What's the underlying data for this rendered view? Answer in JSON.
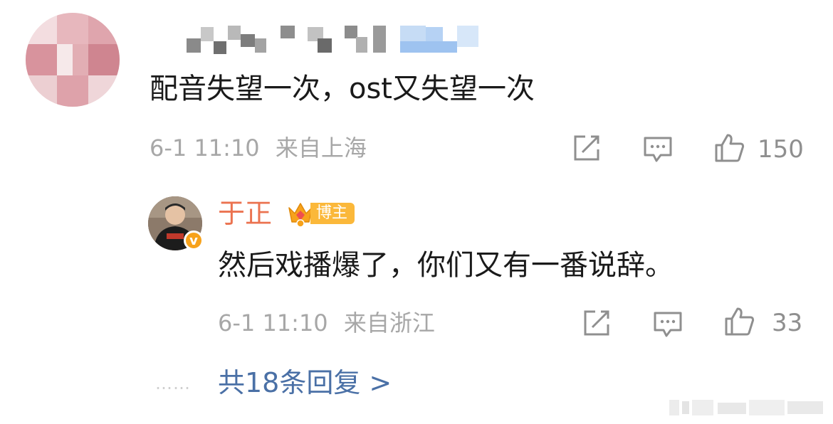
{
  "comment": {
    "text": "配音失望一次，ost又失望一次",
    "time": "6-1 11:10",
    "location": "来自上海",
    "like_count": "150"
  },
  "reply": {
    "author": "于正",
    "badge": "博主",
    "verified": "v",
    "text": "然后戏播爆了，你们又有一番说辞。",
    "time": "6-1 11:10",
    "location": "来自浙江",
    "like_count": "33"
  },
  "more": {
    "dots": "……",
    "label": "共18条回复 >"
  },
  "colors": {
    "accent_name": "#eb7350",
    "link": "#4a70a6",
    "badge": "#fbb83a",
    "meta": "#a7a7a7"
  },
  "icons": [
    "share-icon",
    "comment-icon",
    "like-icon",
    "crown-icon"
  ]
}
